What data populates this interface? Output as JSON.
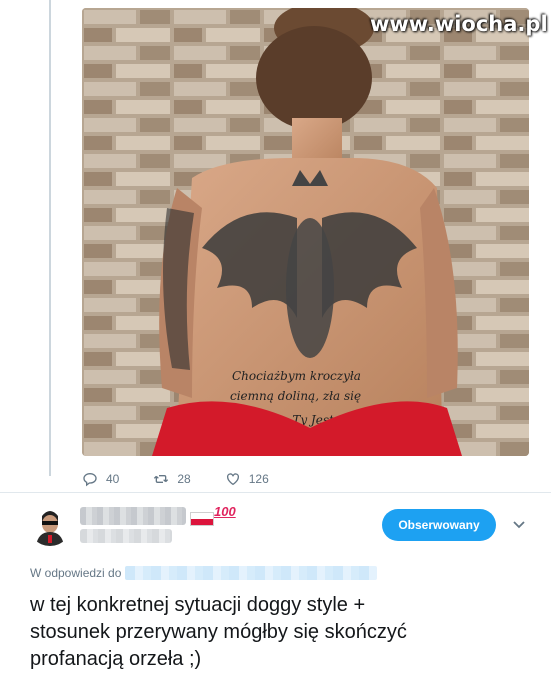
{
  "watermark": "www.wiocha.pl",
  "photo": {
    "tattoo_text_lines": [
      "Chociażbym kroczyła",
      "ciemną doliną, zła się",
      "nie lękę bo Ty Jesteś ze mną"
    ]
  },
  "actions": {
    "reply_count": "40",
    "retweet_count": "28",
    "like_count": "126"
  },
  "reply": {
    "badge_emoji": "100",
    "follow_label": "Obserwowany",
    "in_reply_prefix": "W odpowiedzi do",
    "text": "w tej konkretnej sytuacji doggy style +\nstosunek przerywany mógłby się skończyć\nprofanacją orzeła ;)"
  },
  "colors": {
    "accent": "#1da1f2",
    "muted": "#657786",
    "text": "#14171a",
    "hundred": "#e0245e"
  },
  "icons": {
    "reply": "reply-icon",
    "retweet": "retweet-icon",
    "like": "heart-icon",
    "more": "chevron-down-icon"
  }
}
